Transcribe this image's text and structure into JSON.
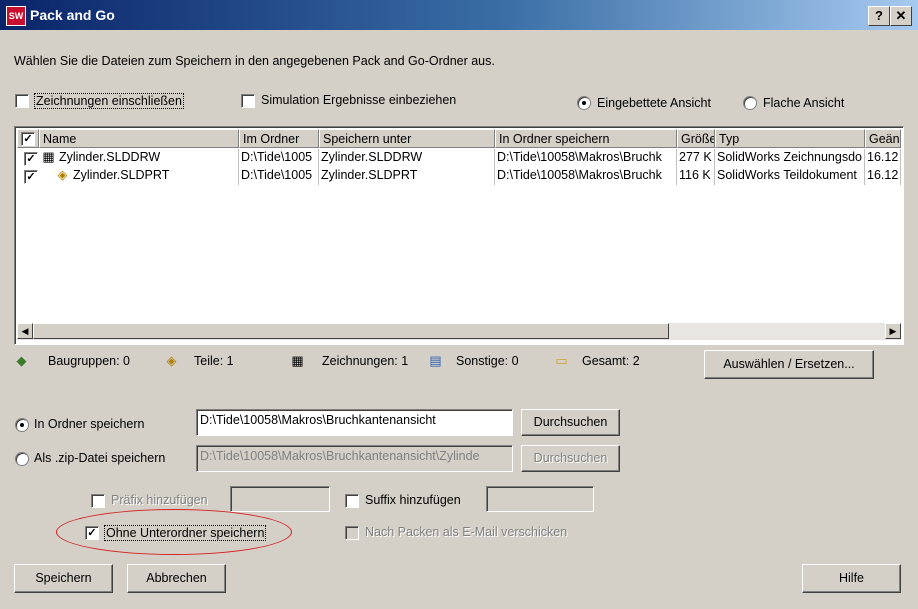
{
  "window": {
    "title": "Pack and Go",
    "icon_text": "SW",
    "help_btn": "?",
    "close_btn": "✕"
  },
  "instruction": "Wählen Sie die Dateien zum Speichern in den angegebenen Pack and Go-Ordner aus.",
  "options": {
    "include_drawings": {
      "label": "Zeichnungen einschließen",
      "checked": false
    },
    "include_simulation": {
      "label": "Simulation Ergebnisse einbeziehen",
      "checked": false
    },
    "nested_view": {
      "label": "Eingebettete Ansicht",
      "selected": true
    },
    "flat_view": {
      "label": "Flache Ansicht",
      "selected": false
    }
  },
  "table": {
    "columns": [
      "Name",
      "Im Ordner",
      "Speichern unter",
      "In Ordner speichern",
      "Größe",
      "Typ",
      "Geänd"
    ],
    "header_checked": "✓",
    "rows": [
      {
        "checked": "✓",
        "name": "Zylinder.SLDDRW",
        "in_folder": "D:\\Tide\\1005",
        "save_as": "Zylinder.SLDDRW",
        "save_to": "D:\\Tide\\10058\\Makros\\Bruchk",
        "size": "277 K",
        "type": "SolidWorks Zeichnungsdo",
        "modified": "16.12"
      },
      {
        "checked": "✓",
        "name": "Zylinder.SLDPRT",
        "in_folder": "D:\\Tide\\1005",
        "save_as": "Zylinder.SLDPRT",
        "save_to": "D:\\Tide\\10058\\Makros\\Bruchk",
        "size": "116 K",
        "type": "SolidWorks Teildokument",
        "modified": "16.12"
      }
    ]
  },
  "summary": {
    "assemblies": "Baugruppen: 0",
    "parts": "Teile: 1",
    "drawings": "Zeichnungen: 1",
    "other": "Sonstige: 0",
    "total": "Gesamt: 2",
    "select_replace_btn": "Auswählen / Ersetzen..."
  },
  "save_folder": {
    "label": "In Ordner speichern",
    "selected": true,
    "path": "D:\\Tide\\10058\\Makros\\Bruchkantenansicht",
    "browse": "Durchsuchen"
  },
  "save_zip": {
    "label": "Als .zip-Datei speichern",
    "selected": false,
    "path": "D:\\Tide\\10058\\Makros\\Bruchkantenansicht\\Zylinde",
    "browse": "Durchsuchen"
  },
  "prefix": {
    "label": "Präfix hinzufügen",
    "checked": false,
    "value": ""
  },
  "suffix": {
    "label": "Suffix hinzufügen",
    "checked": false,
    "value": ""
  },
  "flatten": {
    "label": "Ohne Unterordner speichern",
    "checked": "✓"
  },
  "email": {
    "label": "Nach Packen als E-Mail verschicken",
    "checked": false
  },
  "buttons": {
    "save": "Speichern",
    "cancel": "Abbrechen",
    "help": "Hilfe"
  },
  "colors": {
    "title_start": "#0a246a",
    "title_end": "#a6caf0",
    "dialog_bg": "#d4d0c8",
    "annotation": "#d42020"
  }
}
